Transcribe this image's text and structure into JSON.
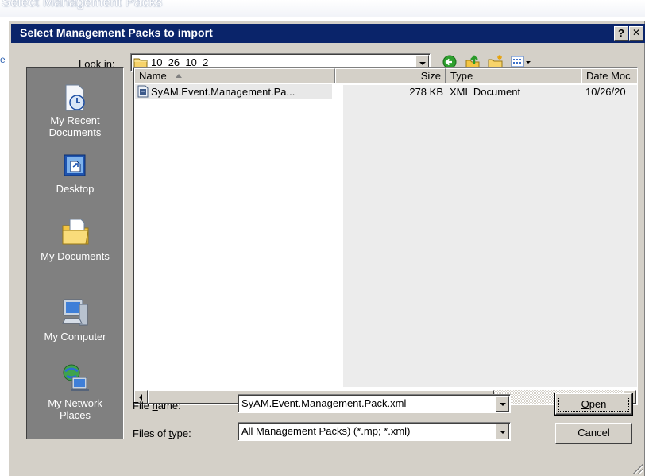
{
  "background": {
    "title": "Select Management Packs",
    "edge_text": "e"
  },
  "dialog": {
    "title": "Select Management Packs to import",
    "help_button": "?",
    "close_button": "✕"
  },
  "lookin": {
    "label_pre": "Look ",
    "label_key": "i",
    "label_post": "n:",
    "folder": "10_26_10_2"
  },
  "toolbar": {
    "icons": [
      "back-icon",
      "up-folder-icon",
      "new-folder-icon",
      "views-menu-icon"
    ]
  },
  "places": [
    {
      "id": "recent",
      "label": "My Recent\nDocuments",
      "icon": "recent-documents-icon"
    },
    {
      "id": "desktop",
      "label": "Desktop",
      "icon": "desktop-icon"
    },
    {
      "id": "documents",
      "label": "My Documents",
      "icon": "my-documents-icon"
    },
    {
      "id": "computer",
      "label": "My Computer",
      "icon": "my-computer-icon"
    },
    {
      "id": "network",
      "label": "My Network\nPlaces",
      "icon": "network-places-icon"
    }
  ],
  "columns": [
    "Name",
    "Size",
    "Type",
    "Date Moc"
  ],
  "files": [
    {
      "name": "SyAM.Event.Management.Pa...",
      "size": "278 KB",
      "type": "XML Document",
      "date": "10/26/20"
    }
  ],
  "filename": {
    "label_pre": "File ",
    "label_key": "n",
    "label_post": "ame:",
    "value": "SyAM.Event.Management.Pack.xml"
  },
  "filetype": {
    "label_pre": "Files of ",
    "label_key": "t",
    "label_post": "ype:",
    "value": "All Management Packs) (*.mp; *.xml)"
  },
  "buttons": {
    "open_key": "O",
    "open_rest": "pen",
    "cancel": "Cancel"
  }
}
